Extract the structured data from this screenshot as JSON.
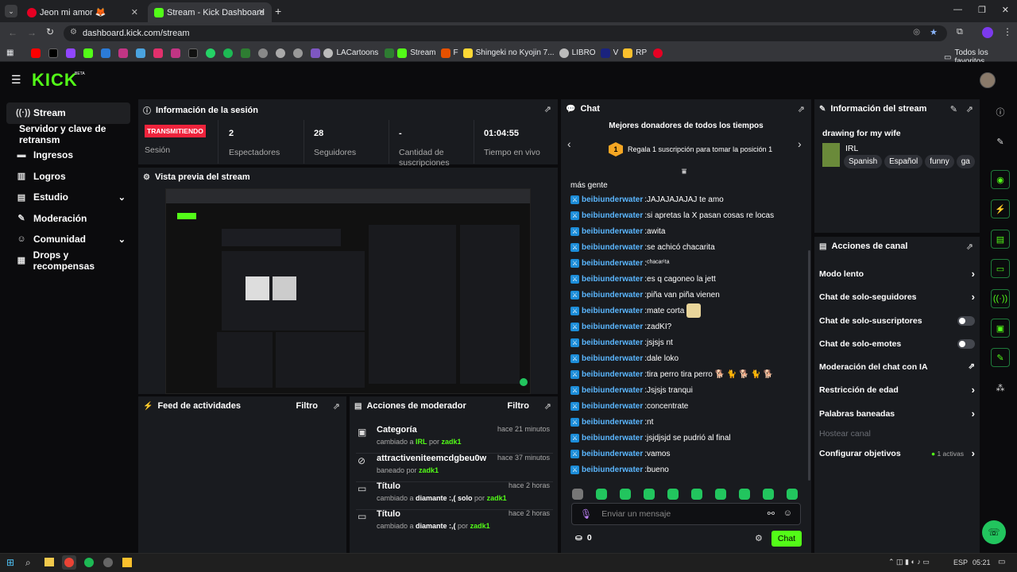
{
  "browser": {
    "tabs": [
      {
        "title": "Jeon mi amor 🦊"
      },
      {
        "title": "Stream - Kick Dashboard"
      }
    ],
    "url": "dashboard.kick.com/stream",
    "bookmarks": [
      "LACartoons",
      "Stream",
      "F",
      "Shingeki no Kyojin 7...",
      "LIBRO",
      "V",
      "RP"
    ],
    "all_favorites": "Todos los favoritos"
  },
  "kick": {
    "logo": "KICK",
    "beta": "BETA"
  },
  "sidebar": {
    "items": [
      {
        "label": "Stream",
        "icon": "broadcast-icon"
      },
      {
        "label": "Servidor y clave de retransm"
      },
      {
        "label": "Ingresos",
        "icon": "money-icon"
      },
      {
        "label": "Logros",
        "icon": "trophy-icon"
      },
      {
        "label": "Estudio",
        "icon": "studio-icon"
      },
      {
        "label": "Moderación",
        "icon": "wrench-icon"
      },
      {
        "label": "Comunidad",
        "icon": "community-icon"
      },
      {
        "label": "Drops y recompensas",
        "icon": "drops-icon"
      }
    ]
  },
  "session": {
    "title": "Información de la sesión",
    "status": "TRANSMITIENDO",
    "status_label": "Sesión",
    "stats": [
      {
        "value": "2",
        "label": "Espectadores"
      },
      {
        "value": "28",
        "label": "Seguidores"
      },
      {
        "value": "-",
        "label": "Cantidad de suscripciones"
      },
      {
        "value": "01:04:55",
        "label": "Tiempo en vivo"
      }
    ]
  },
  "preview": {
    "title": "Vista previa del stream"
  },
  "activity": {
    "title": "Feed de actividades",
    "filter": "Filtro"
  },
  "modactions": {
    "title": "Acciones de moderador",
    "filter": "Filtro",
    "rows": [
      {
        "title": "Categoría",
        "pre": "cambiado a ",
        "val": "IRL",
        "mid": " por ",
        "by": "zadk1",
        "time": "hace 21 minutos"
      },
      {
        "title": "attractiveniteemcdgbeu0w",
        "pre": "baneado por ",
        "val": "",
        "mid": "",
        "by": "zadk1",
        "time": "hace 37 minutos"
      },
      {
        "title": "Título",
        "pre": "cambiado a ",
        "val": "diamante :,( solo",
        "mid": " por ",
        "by": "zadk1",
        "time": "hace 2 horas"
      },
      {
        "title": "Título",
        "pre": "cambiado a ",
        "val": "diamante :,(",
        "mid": " por ",
        "by": "zadk1",
        "time": "hace 2 horas"
      }
    ]
  },
  "chat": {
    "title": "Chat",
    "donors_title": "Mejores donadores de todos los tiempos",
    "donor_rank": "1",
    "donor_text": "Regala 1 suscripción para tomar la posición 1",
    "partial_msg": "más gente",
    "messages": [
      {
        "user": "beibiunderwater",
        "text": "JAJAJAJAJAJ te amo"
      },
      {
        "user": "beibiunderwater",
        "text": "si apretas la X pasan cosas re locas"
      },
      {
        "user": "beibiunderwater",
        "text": "awita"
      },
      {
        "user": "beibiunderwater",
        "text": "se achicó chacarita"
      },
      {
        "user": "beibiunderwater",
        "text": "ᶜʰᵃᶜᵃʳⁱᵗᵃ"
      },
      {
        "user": "beibiunderwater",
        "text": "es q cagoneo la jett"
      },
      {
        "user": "beibiunderwater",
        "text": "piña van piña vienen"
      },
      {
        "user": "beibiunderwater",
        "text": "mate corta"
      },
      {
        "user": "beibiunderwater",
        "text": "zadKI?"
      },
      {
        "user": "beibiunderwater",
        "text": "jsjsjs nt"
      },
      {
        "user": "beibiunderwater",
        "text": "dale loko"
      },
      {
        "user": "beibiunderwater",
        "text": "tira perro tira perro 🐕 🐈 🐕 🐈 🐕"
      },
      {
        "user": "beibiunderwater",
        "text": "Jsjsjs tranqui"
      },
      {
        "user": "beibiunderwater",
        "text": "concentrate"
      },
      {
        "user": "beibiunderwater",
        "text": "nt"
      },
      {
        "user": "beibiunderwater",
        "text": "jsjdjsjd se pudrió al final"
      },
      {
        "user": "beibiunderwater",
        "text": "vamos"
      },
      {
        "user": "beibiunderwater",
        "text": "bueno"
      }
    ],
    "input_placeholder": "Enviar un mensaje",
    "points": "0",
    "send_label": "Chat"
  },
  "streaminfo": {
    "title": "Información del stream",
    "stream_title": "drawing for my wife",
    "category": "IRL",
    "tags": [
      "Spanish",
      "Español",
      "funny",
      "ga"
    ]
  },
  "channel": {
    "title": "Acciones de canal",
    "rows": [
      {
        "label": "Modo lento"
      },
      {
        "label": "Chat de solo-seguidores"
      },
      {
        "label": "Chat de solo-suscriptores"
      },
      {
        "label": "Chat de solo-emotes"
      },
      {
        "label": "Moderación del chat con IA"
      },
      {
        "label": "Restricción de edad"
      },
      {
        "label": "Palabras baneadas"
      },
      {
        "label": "Hostear canal"
      },
      {
        "label": "Configurar objetivos"
      }
    ],
    "active_goals": "1 activas"
  },
  "taskbar": {
    "lang": "ESP",
    "time": "05:21"
  },
  "colors": {
    "accent": "#53fc18",
    "live": "#ef233c",
    "panel": "#191b1f",
    "username": "#5bb7ff"
  }
}
